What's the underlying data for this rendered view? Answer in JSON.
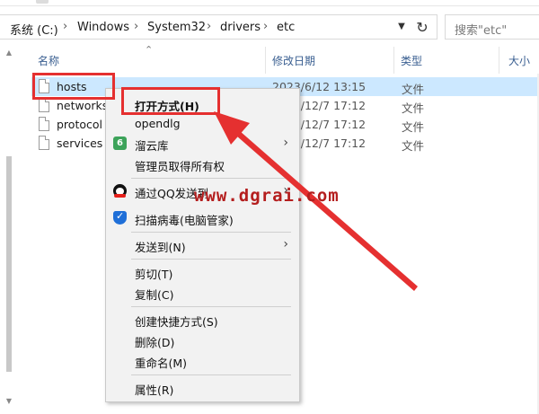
{
  "address": {
    "crumbs": [
      "系统 (C:)",
      "Windows",
      "System32",
      "drivers",
      "etc"
    ],
    "separator": "›"
  },
  "search": {
    "placeholder": "搜索\"etc\""
  },
  "columns": {
    "name": "名称",
    "date": "修改日期",
    "type": "类型",
    "size": "大小"
  },
  "files": [
    {
      "name": "hosts",
      "date": "2023/6/12 13:15",
      "type": "文件",
      "selected": true
    },
    {
      "name": "networks",
      "date": "2019/12/7 17:12",
      "type": "文件",
      "selected": false
    },
    {
      "name": "protocol",
      "date": "2019/12/7 17:12",
      "type": "文件",
      "selected": false
    },
    {
      "name": "services",
      "date": "2019/12/7 17:12",
      "type": "文件",
      "selected": false
    }
  ],
  "context_menu": {
    "open_with": "打开方式(H)",
    "opendlg": "opendlg",
    "liuyunku": "溜云库",
    "take_ownership": "管理员取得所有权",
    "send_qq": "通过QQ发送到",
    "scan_virus": "扫描病毒(电脑管家)",
    "send_to": "发送到(N)",
    "cut": "剪切(T)",
    "copy": "复制(C)",
    "create_shortcut": "创建快捷方式(S)",
    "delete": "删除(D)",
    "rename": "重命名(M)",
    "properties": "属性(R)",
    "submenu_arrow": "›"
  },
  "watermark": "www.dgrai.com",
  "colors": {
    "highlight_red": "#e53030",
    "selection_blue": "#cce8ff",
    "header_text": "#3a5f91",
    "watermark": "#b41e1e"
  }
}
